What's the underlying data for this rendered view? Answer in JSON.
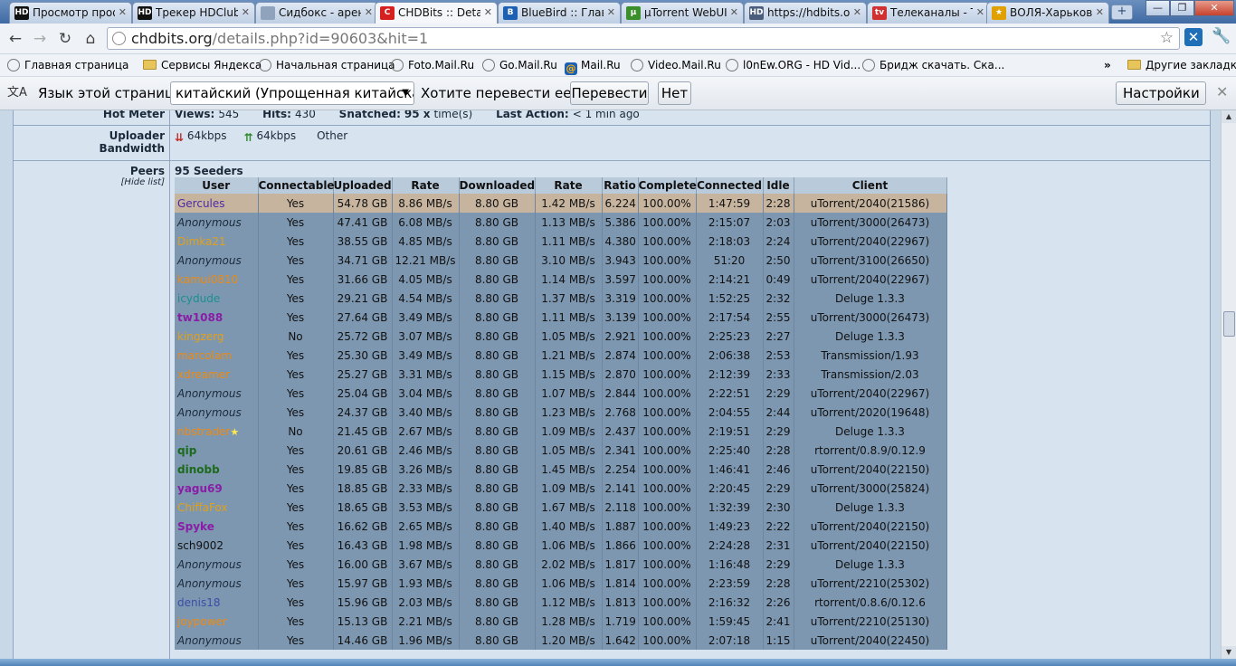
{
  "tabs": [
    {
      "title": "Просмотр проф",
      "fav": "HD",
      "color": "#111111",
      "active": false
    },
    {
      "title": "Трекер HDClub",
      "fav": "HD",
      "color": "#111111",
      "active": false
    },
    {
      "title": "Сидбокс - арен",
      "fav": "",
      "color": "#8fa3bd",
      "active": false
    },
    {
      "title": "CHDBits :: Detail",
      "fav": "C",
      "color": "#d62020",
      "active": true
    },
    {
      "title": "BlueBird :: Главн",
      "fav": "B",
      "color": "#1d5fb0",
      "active": false
    },
    {
      "title": "µTorrent WebUI",
      "fav": "µ",
      "color": "#3b8f2a",
      "active": false
    },
    {
      "title": "https://hdbits.or",
      "fav": "HD",
      "color": "#4a5d7a",
      "active": false
    },
    {
      "title": "Телеканалы - Т",
      "fav": "tv",
      "color": "#d03030",
      "active": false
    },
    {
      "title": "ВОЛЯ-Харьков -",
      "fav": "★",
      "color": "#e0a000",
      "active": false
    }
  ],
  "toolbar": {
    "url_host": "chdbits.org",
    "url_rest": "/details.php?id=90603&hit=1"
  },
  "bookmarks": [
    {
      "label": "Главная страница",
      "type": "globe"
    },
    {
      "label": "Сервисы Яндекса",
      "type": "folder"
    },
    {
      "label": "Начальная страница",
      "type": "globe"
    },
    {
      "label": "Foto.Mail.Ru",
      "type": "globe"
    },
    {
      "label": "Go.Mail.Ru",
      "type": "globe"
    },
    {
      "label": "Mail.Ru",
      "type": "mail"
    },
    {
      "label": "Video.Mail.Ru",
      "type": "globe"
    },
    {
      "label": "l0nEw.ORG - HD Vid...",
      "type": "globe"
    },
    {
      "label": "Бридж скачать. Ска...",
      "type": "globe"
    }
  ],
  "bookmarks_overflow": "»",
  "bookmarks_other": "Другие закладки",
  "translate": {
    "label": "Язык этой страницы",
    "language": "китайский (Упрощенная китайская)",
    "question": "Хотите перевести ее?",
    "translate_btn": "Перевести",
    "no_btn": "Нет",
    "settings_btn": "Настройки"
  },
  "details": {
    "hot_meter_label": "Hot Meter",
    "views_label": "Views:",
    "views": "545",
    "hits_label": "Hits:",
    "hits": "430",
    "snatched_label": "Snatched:",
    "snatched": "95 x",
    "snatched_suffix": "time(s)",
    "last_action_label": "Last Action:",
    "last_action": "< 1 min ago",
    "bandwidth_label_1": "Uploader",
    "bandwidth_label_2": "Bandwidth",
    "down_speed": "64kbps",
    "up_speed": "64kbps",
    "bandwidth_other": "Other",
    "peers_label": "Peers",
    "hide_list": "[Hide list]",
    "seeders": "95 Seeders"
  },
  "peers": {
    "headers": [
      "User",
      "Connectable",
      "Uploaded",
      "Rate",
      "Downloaded",
      "Rate",
      "Ratio",
      "Complete",
      "Connected",
      "Idle",
      "Client"
    ],
    "rows": [
      {
        "user": "Gercules",
        "cls": "u-purple",
        "conn": "Yes",
        "up": "54.78 GB",
        "urate": "8.86 MB/s",
        "down": "8.80 GB",
        "drate": "1.42 MB/s",
        "ratio": "6.224",
        "comp": "100.00%",
        "connected": "1:47:59",
        "idle": "2:28",
        "client": "uTorrent/2040(21586)",
        "hl": true
      },
      {
        "user": "Anonymous",
        "cls": "u-anon",
        "conn": "Yes",
        "up": "47.41 GB",
        "urate": "6.08 MB/s",
        "down": "8.80 GB",
        "drate": "1.13 MB/s",
        "ratio": "5.386",
        "comp": "100.00%",
        "connected": "2:15:07",
        "idle": "2:03",
        "client": "uTorrent/3000(26473)"
      },
      {
        "user": "Dimka21",
        "cls": "u-gold",
        "conn": "Yes",
        "up": "38.55 GB",
        "urate": "4.85 MB/s",
        "down": "8.80 GB",
        "drate": "1.11 MB/s",
        "ratio": "4.380",
        "comp": "100.00%",
        "connected": "2:18:03",
        "idle": "2:24",
        "client": "uTorrent/2040(22967)"
      },
      {
        "user": "Anonymous",
        "cls": "u-anon",
        "conn": "Yes",
        "up": "34.71 GB",
        "urate": "12.21 MB/s",
        "down": "8.80 GB",
        "drate": "3.10 MB/s",
        "ratio": "3.943",
        "comp": "100.00%",
        "connected": "51:20",
        "idle": "2:50",
        "client": "uTorrent/3100(26650)"
      },
      {
        "user": "kamui0810",
        "cls": "u-orange",
        "conn": "Yes",
        "up": "31.66 GB",
        "urate": "4.05 MB/s",
        "down": "8.80 GB",
        "drate": "1.14 MB/s",
        "ratio": "3.597",
        "comp": "100.00%",
        "connected": "2:14:21",
        "idle": "0:49",
        "client": "uTorrent/2040(22967)"
      },
      {
        "user": "icydude",
        "cls": "u-teal",
        "conn": "Yes",
        "up": "29.21 GB",
        "urate": "4.54 MB/s",
        "down": "8.80 GB",
        "drate": "1.37 MB/s",
        "ratio": "3.319",
        "comp": "100.00%",
        "connected": "1:52:25",
        "idle": "2:32",
        "client": "Deluge 1.3.3"
      },
      {
        "user": "tw1088",
        "cls": "u-violet",
        "conn": "Yes",
        "up": "27.64 GB",
        "urate": "3.49 MB/s",
        "down": "8.80 GB",
        "drate": "1.11 MB/s",
        "ratio": "3.139",
        "comp": "100.00%",
        "connected": "2:17:54",
        "idle": "2:55",
        "client": "uTorrent/3000(26473)"
      },
      {
        "user": "kingzerg",
        "cls": "u-gold",
        "conn": "No",
        "up": "25.72 GB",
        "urate": "3.07 MB/s",
        "down": "8.80 GB",
        "drate": "1.05 MB/s",
        "ratio": "2.921",
        "comp": "100.00%",
        "connected": "2:25:23",
        "idle": "2:27",
        "client": "Deluge 1.3.3"
      },
      {
        "user": "marcolam",
        "cls": "u-orange",
        "conn": "Yes",
        "up": "25.30 GB",
        "urate": "3.49 MB/s",
        "down": "8.80 GB",
        "drate": "1.21 MB/s",
        "ratio": "2.874",
        "comp": "100.00%",
        "connected": "2:06:38",
        "idle": "2:53",
        "client": "Transmission/1.93"
      },
      {
        "user": "xdreamer",
        "cls": "u-orange",
        "conn": "Yes",
        "up": "25.27 GB",
        "urate": "3.31 MB/s",
        "down": "8.80 GB",
        "drate": "1.15 MB/s",
        "ratio": "2.870",
        "comp": "100.00%",
        "connected": "2:12:39",
        "idle": "2:33",
        "client": "Transmission/2.03"
      },
      {
        "user": "Anonymous",
        "cls": "u-anon",
        "conn": "Yes",
        "up": "25.04 GB",
        "urate": "3.04 MB/s",
        "down": "8.80 GB",
        "drate": "1.07 MB/s",
        "ratio": "2.844",
        "comp": "100.00%",
        "connected": "2:22:51",
        "idle": "2:29",
        "client": "uTorrent/2040(22967)"
      },
      {
        "user": "Anonymous",
        "cls": "u-anon",
        "conn": "Yes",
        "up": "24.37 GB",
        "urate": "3.40 MB/s",
        "down": "8.80 GB",
        "drate": "1.23 MB/s",
        "ratio": "2.768",
        "comp": "100.00%",
        "connected": "2:04:55",
        "idle": "2:44",
        "client": "uTorrent/2020(19648)"
      },
      {
        "user": "nbstrader",
        "cls": "u-orange",
        "star": true,
        "conn": "No",
        "up": "21.45 GB",
        "urate": "2.67 MB/s",
        "down": "8.80 GB",
        "drate": "1.09 MB/s",
        "ratio": "2.437",
        "comp": "100.00%",
        "connected": "2:19:51",
        "idle": "2:29",
        "client": "Deluge 1.3.3"
      },
      {
        "user": "qip",
        "cls": "u-green",
        "conn": "Yes",
        "up": "20.61 GB",
        "urate": "2.46 MB/s",
        "down": "8.80 GB",
        "drate": "1.05 MB/s",
        "ratio": "2.341",
        "comp": "100.00%",
        "connected": "2:25:40",
        "idle": "2:28",
        "client": "rtorrent/0.8.9/0.12.9"
      },
      {
        "user": "dinobb",
        "cls": "u-green",
        "conn": "Yes",
        "up": "19.85 GB",
        "urate": "3.26 MB/s",
        "down": "8.80 GB",
        "drate": "1.45 MB/s",
        "ratio": "2.254",
        "comp": "100.00%",
        "connected": "1:46:41",
        "idle": "2:46",
        "client": "uTorrent/2040(22150)"
      },
      {
        "user": "yagu69",
        "cls": "u-violet",
        "conn": "Yes",
        "up": "18.85 GB",
        "urate": "2.33 MB/s",
        "down": "8.80 GB",
        "drate": "1.09 MB/s",
        "ratio": "2.141",
        "comp": "100.00%",
        "connected": "2:20:45",
        "idle": "2:29",
        "client": "uTorrent/3000(25824)"
      },
      {
        "user": "ChiffaFox",
        "cls": "u-gold",
        "conn": "Yes",
        "up": "18.65 GB",
        "urate": "3.53 MB/s",
        "down": "8.80 GB",
        "drate": "1.67 MB/s",
        "ratio": "2.118",
        "comp": "100.00%",
        "connected": "1:32:39",
        "idle": "2:30",
        "client": "Deluge 1.3.3"
      },
      {
        "user": "Spyke",
        "cls": "u-violet",
        "conn": "Yes",
        "up": "16.62 GB",
        "urate": "2.65 MB/s",
        "down": "8.80 GB",
        "drate": "1.40 MB/s",
        "ratio": "1.887",
        "comp": "100.00%",
        "connected": "1:49:23",
        "idle": "2:22",
        "client": "uTorrent/2040(22150)"
      },
      {
        "user": "sch9002",
        "cls": "u-black",
        "conn": "Yes",
        "up": "16.43 GB",
        "urate": "1.98 MB/s",
        "down": "8.80 GB",
        "drate": "1.06 MB/s",
        "ratio": "1.866",
        "comp": "100.00%",
        "connected": "2:24:28",
        "idle": "2:31",
        "client": "uTorrent/2040(22150)"
      },
      {
        "user": "Anonymous",
        "cls": "u-anon",
        "conn": "Yes",
        "up": "16.00 GB",
        "urate": "3.67 MB/s",
        "down": "8.80 GB",
        "drate": "2.02 MB/s",
        "ratio": "1.817",
        "comp": "100.00%",
        "connected": "1:16:48",
        "idle": "2:29",
        "client": "Deluge 1.3.3"
      },
      {
        "user": "Anonymous",
        "cls": "u-anon",
        "conn": "Yes",
        "up": "15.97 GB",
        "urate": "1.93 MB/s",
        "down": "8.80 GB",
        "drate": "1.06 MB/s",
        "ratio": "1.814",
        "comp": "100.00%",
        "connected": "2:23:59",
        "idle": "2:28",
        "client": "uTorrent/2210(25302)"
      },
      {
        "user": "denis18",
        "cls": "u-blue",
        "conn": "Yes",
        "up": "15.96 GB",
        "urate": "2.03 MB/s",
        "down": "8.80 GB",
        "drate": "1.12 MB/s",
        "ratio": "1.813",
        "comp": "100.00%",
        "connected": "2:16:32",
        "idle": "2:26",
        "client": "rtorrent/0.8.6/0.12.6"
      },
      {
        "user": "joypower",
        "cls": "u-orange",
        "conn": "Yes",
        "up": "15.13 GB",
        "urate": "2.21 MB/s",
        "down": "8.80 GB",
        "drate": "1.28 MB/s",
        "ratio": "1.719",
        "comp": "100.00%",
        "connected": "1:59:45",
        "idle": "2:41",
        "client": "uTorrent/2210(25130)"
      },
      {
        "user": "Anonymous",
        "cls": "u-anon",
        "conn": "Yes",
        "up": "14.46 GB",
        "urate": "1.96 MB/s",
        "down": "8.80 GB",
        "drate": "1.20 MB/s",
        "ratio": "1.642",
        "comp": "100.00%",
        "connected": "2:07:18",
        "idle": "1:15",
        "client": "uTorrent/2040(22450)"
      }
    ]
  }
}
